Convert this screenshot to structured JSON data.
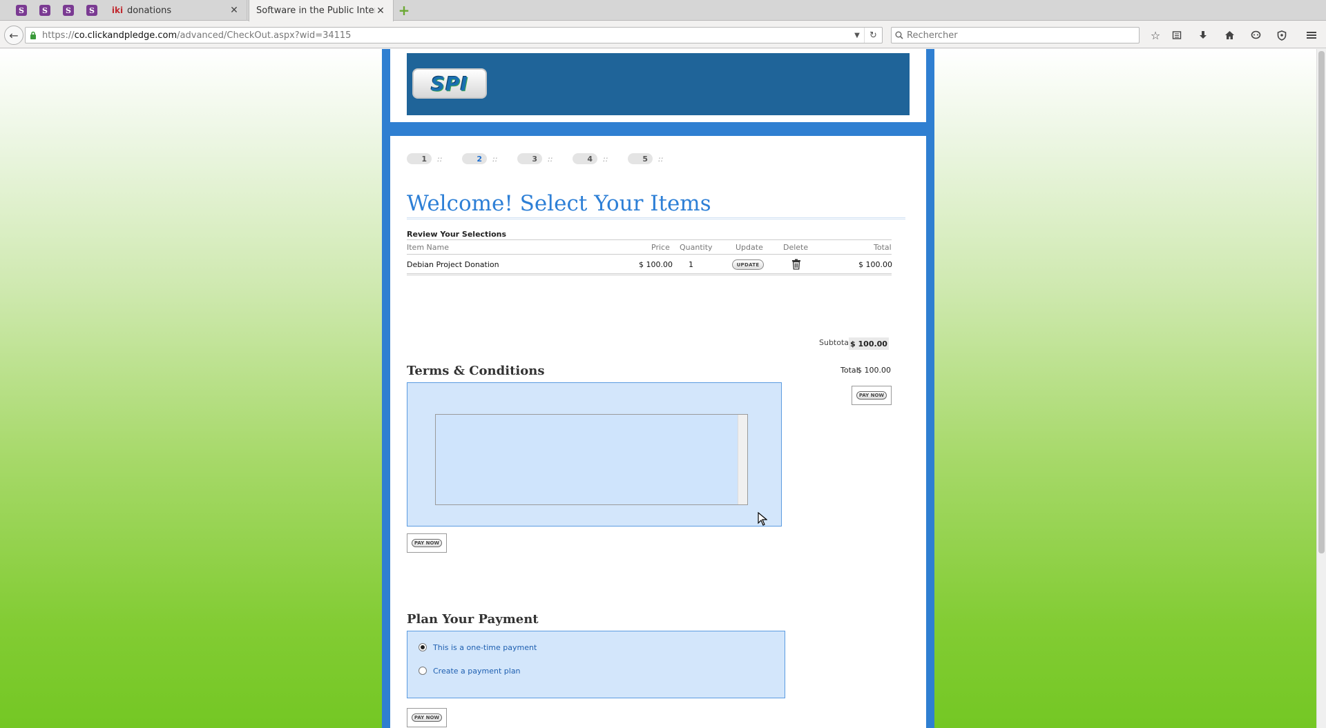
{
  "browser": {
    "pinned_tabs": [
      "S",
      "S",
      "S",
      "S"
    ],
    "tabs": [
      {
        "title": "donations",
        "favicon": "iki",
        "active": false
      },
      {
        "title": "Software in the Public Inter...",
        "favicon": "",
        "active": true
      }
    ],
    "url_host": "co.clickandpledge.com",
    "url_prefix": "https://",
    "url_path": "/advanced/CheckOut.aspx?wid=34115",
    "search_placeholder": "Rechercher",
    "icons": [
      "back-icon",
      "lock-icon",
      "reload-icon",
      "search-icon",
      "bookmark-star-icon",
      "reading-list-icon",
      "download-icon",
      "home-icon",
      "chat-icon",
      "shield-icon",
      "menu-icon"
    ]
  },
  "page": {
    "logo_text": "SPI",
    "steps": [
      "1",
      "2",
      "3",
      "4",
      "5"
    ],
    "current_step": "2",
    "step_separator": "::",
    "title": "Welcome! Select Your Items",
    "review_heading": "Review Your Selections",
    "table": {
      "headers": [
        "Item Name",
        "Price",
        "Quantity",
        "Update",
        "Delete",
        "Total"
      ],
      "rows": [
        {
          "item": "Debian Project Donation",
          "price": "$ 100.00",
          "quantity": "1",
          "update_label": "UPDATE",
          "total": "$ 100.00"
        }
      ]
    },
    "subtotal_label": "Subtotal",
    "subtotal_value": "$ 100.00",
    "total_label": "Total",
    "total_value": "$ 100.00",
    "pay_now_label": "PAY NOW",
    "terms_heading": "Terms & Conditions",
    "plan_heading": "Plan Your Payment",
    "payment_options": [
      {
        "label": "This is a one-time payment",
        "selected": true
      },
      {
        "label": "Create a payment plan",
        "selected": false
      }
    ]
  },
  "colors": {
    "frame_blue": "#2f7fd1",
    "banner_blue": "#1f6499",
    "title_blue": "#2d7fd6",
    "panel_blue": "#d3e6fb",
    "background_green": "#74c724"
  }
}
